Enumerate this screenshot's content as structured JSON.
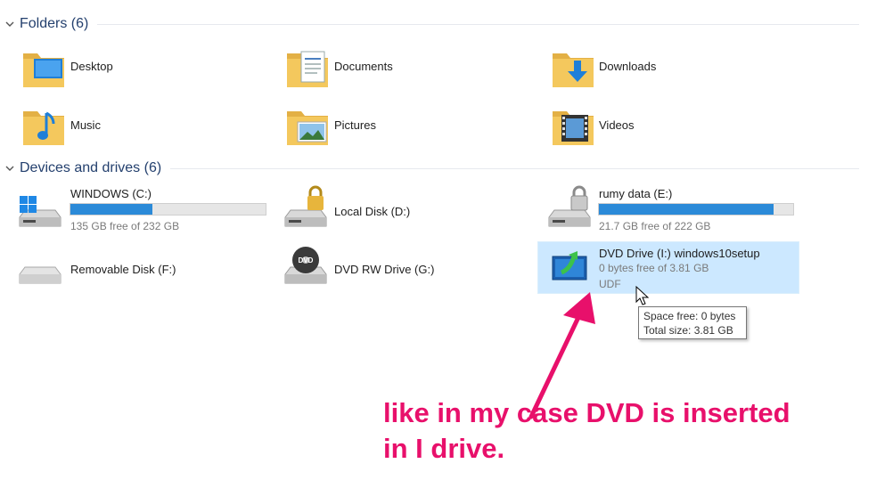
{
  "folders_group": {
    "title": "Folders (6)"
  },
  "folders": [
    {
      "name": "Desktop",
      "icon": "desktop-folder-icon"
    },
    {
      "name": "Documents",
      "icon": "documents-folder-icon"
    },
    {
      "name": "Downloads",
      "icon": "downloads-folder-icon"
    },
    {
      "name": "Music",
      "icon": "music-folder-icon"
    },
    {
      "name": "Pictures",
      "icon": "pictures-folder-icon"
    },
    {
      "name": "Videos",
      "icon": "videos-folder-icon"
    }
  ],
  "devices_group": {
    "title": "Devices and drives (6)"
  },
  "drives": [
    {
      "name": "WINDOWS (C:)",
      "detail": "135 GB free of 232 GB",
      "used_fraction": 0.42,
      "icon": "windows-drive-icon"
    },
    {
      "name": "Local Disk (D:)",
      "icon": "locked-drive-icon"
    },
    {
      "name": "rumy data (E:)",
      "detail": "21.7 GB free of 222 GB",
      "used_fraction": 0.9,
      "icon": "locked-drive-icon"
    },
    {
      "name": "Removable Disk (F:)",
      "icon": "removable-drive-icon"
    },
    {
      "name": "DVD RW Drive (G:)",
      "icon": "dvd-drive-icon"
    },
    {
      "name": "DVD Drive (I:) windows10setup",
      "detail": "0 bytes free of 3.81 GB",
      "filesystem": "UDF",
      "icon": "dvd-setup-icon"
    }
  ],
  "tooltip": {
    "line1": "Space free: 0 bytes",
    "line2": "Total size: 3.81 GB"
  },
  "annotation": {
    "line1": "like in my case DVD is inserted",
    "line2": "in I drive."
  },
  "colors": {
    "accent": "#2b8ad8",
    "annotation": "#e8106b",
    "selection": "#cce8ff"
  }
}
